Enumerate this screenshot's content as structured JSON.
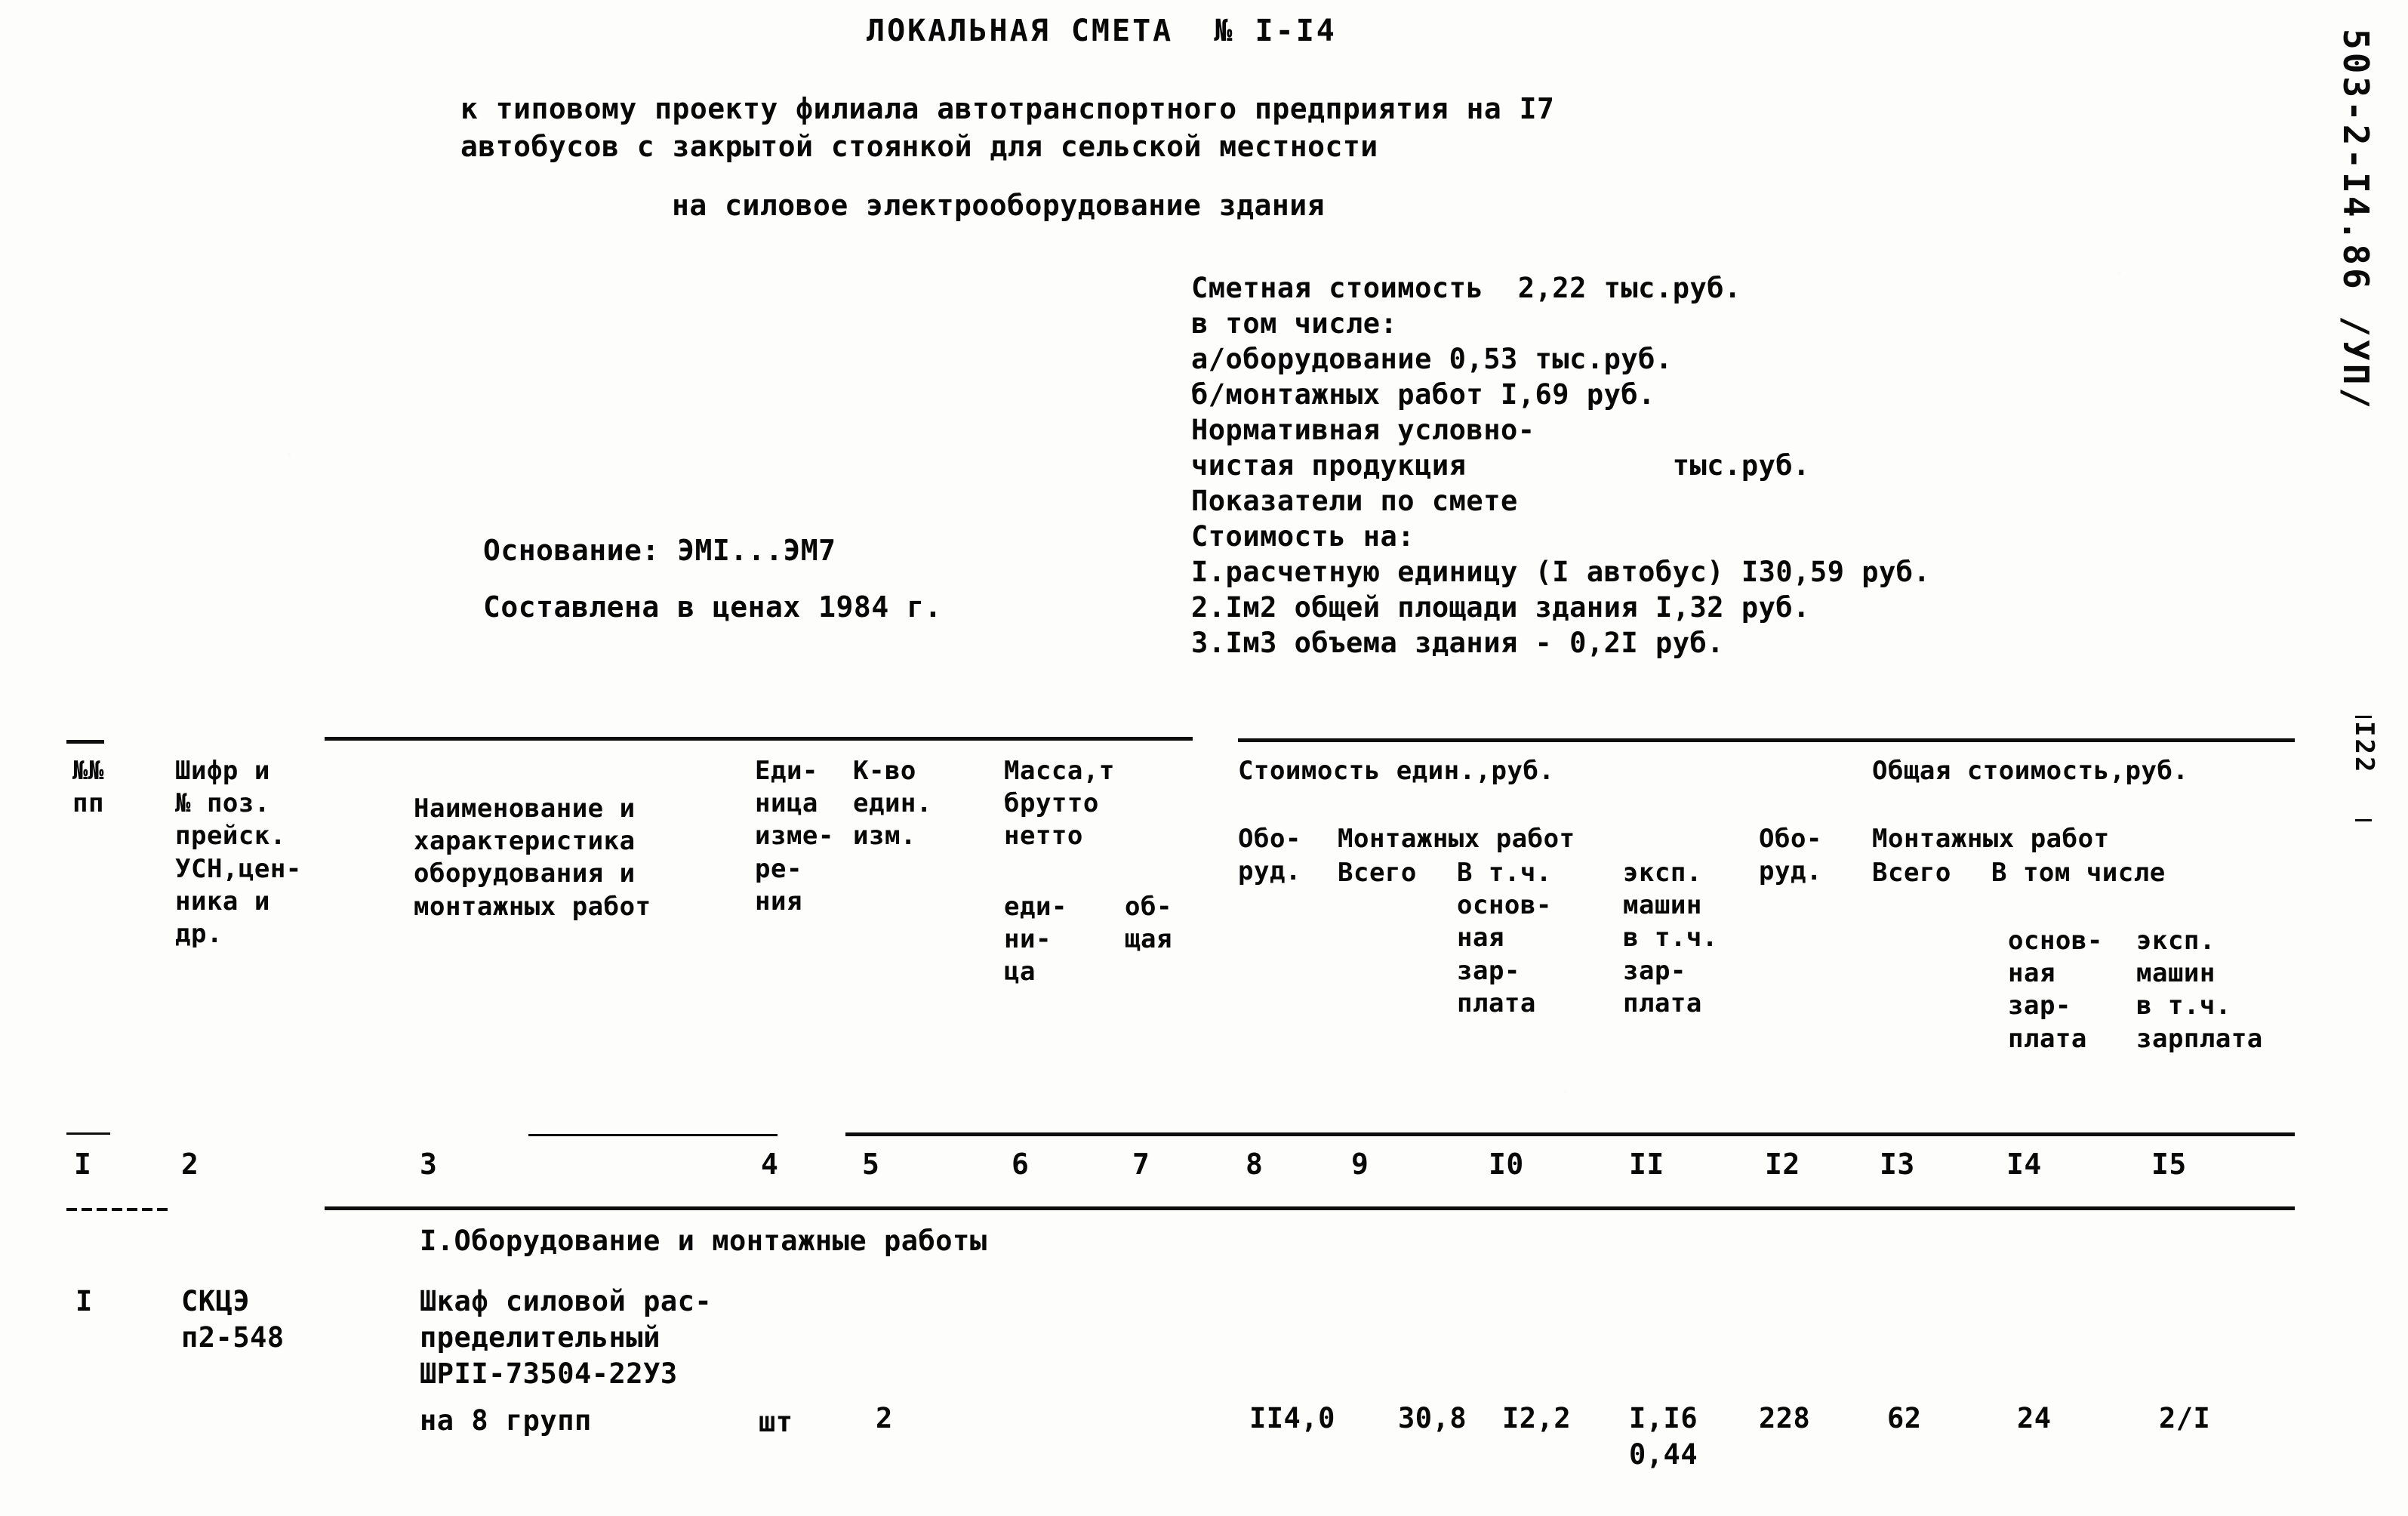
{
  "document": {
    "title": "ЛОКАЛЬНАЯ СМЕТА  № I-I4",
    "subtitle_line1": "к типовому проекту филиала автотранспортного предприятия на I7",
    "subtitle_line2": "автобусов с закрытой стоянкой для сельской местности",
    "subtitle_line3": "на силовое электрооборудование здания",
    "margin_code": "503-2-I4.86 /УП/",
    "margin_page": "I22"
  },
  "summary": {
    "line1": "Сметная стоимость  2,22 тыс.руб.",
    "line2": "в том числе:",
    "line3": "а/оборудование 0,53 тыс.руб.",
    "line4": "б/монтажных работ I,69 руб.",
    "line5": "Нормативная условно-",
    "line6": "чистая продукция            тыс.руб.",
    "line7": "Показатели по смете",
    "line8": "Стоимость на:",
    "line9": "I.расчетную единицу (I автобус) I30,59 руб.",
    "line10": "2.Iм2 общей площади здания I,32 руб.",
    "line11": "3.Iм3 объема здания - 0,2I руб."
  },
  "basis": {
    "line1": "Основание: ЭМI...ЭМ7",
    "line2": "Составлена в ценах 1984 г."
  },
  "table": {
    "headers": {
      "col1": "№№\nпп",
      "col2": "Шифр и\n№ поз.\nпрейск.\nУСН,цен-\nника и\nдр.",
      "col3": "Наименование и\nхарактеристика\nоборудования и\nмонтажных работ",
      "col4": "Еди-\nница\nизме-\nре-\nния",
      "col5": "К-во\nедин.\nизм.",
      "col6_group": "Масса,т\nбрутто\nнетто",
      "col6": "еди-\nни-\nца",
      "col7": "об-\nщая",
      "group_unit_cost": "Стоимость един.,руб.",
      "col8": "Обо-\nруд.",
      "col9_group": "Монтажных работ",
      "col9": "Всего",
      "col10": "В т.ч.\nоснов-\nная\nзар-\nплата",
      "col11": "эксп.\nмашин\nв т.ч.\nзар-\nплата",
      "col12": "Обо-\nруд.",
      "group_total_cost": "Общая стоимость,руб.",
      "col13_group": "Монтажных работ",
      "col13": "Всего",
      "col14_group": "В том числе",
      "col14": "основ-\nная\nзар-\nплата",
      "col15": "эксп.\nмашин\nв т.ч.\nзарплата"
    },
    "column_numbers": [
      "I",
      "2",
      "3",
      "4",
      "5",
      "6",
      "7",
      "8",
      "9",
      "I0",
      "II",
      "I2",
      "I3",
      "I4",
      "I5"
    ],
    "section_title": "I.Оборудование и монтажные работы",
    "rows": [
      {
        "num": "I",
        "cipher_line1": "СКЦЭ",
        "cipher_line2": "п2-548",
        "name_line1": "Шкаф силовой рас-",
        "name_line2": "пределительный",
        "name_line3": "ШРII-73504-22У3",
        "name_line4": "на 8 групп",
        "unit": "шт",
        "qty": "2",
        "mass_unit": "",
        "mass_total": "",
        "unit_equip": "",
        "unit_mont_total": "II4,0",
        "unit_mont_salary": "30,8",
        "unit_mach": "I2,2",
        "unit_mach_salary_top": "I,I6",
        "unit_mach_salary_bottom": "0,44",
        "total_equip": "228",
        "total_mont": "62",
        "total_salary": "24",
        "total_mach": "2/I"
      }
    ]
  }
}
